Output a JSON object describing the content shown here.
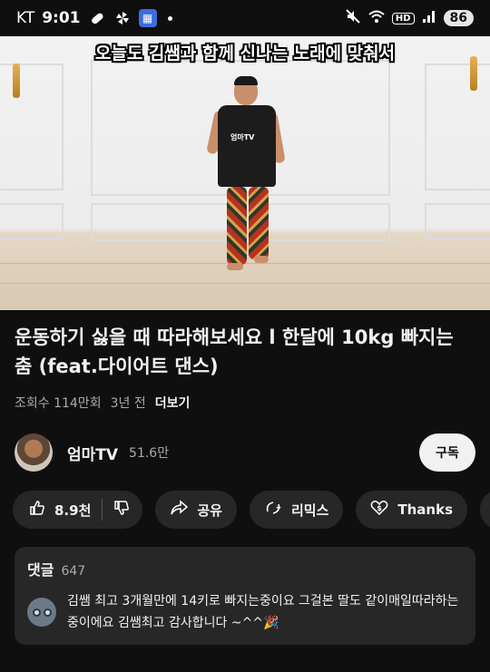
{
  "status_bar": {
    "carrier": "KT",
    "time": "9:01",
    "network_badge": "HD",
    "battery": "86"
  },
  "video": {
    "caption": "오늘도 김쌤과 함께 신나는 노래에 맞춰서",
    "shirt_logo": "엄마TV"
  },
  "title": "운동하기 싫을 때 따라해보세요 l 한달에 10kg 빠지는 춤 (feat.다이어트 댄스)",
  "meta": {
    "views": "조회수 114만회",
    "age": "3년 전",
    "more": "더보기"
  },
  "channel": {
    "name": "엄마TV",
    "subscribers": "51.6만",
    "subscribe_label": "구독"
  },
  "actions": {
    "likes": "8.9천",
    "share": "공유",
    "remix": "리믹스",
    "thanks": "Thanks"
  },
  "comments": {
    "title": "댓글",
    "count": "647",
    "top_comment": "김쌤 최고 3개월만에 14키로 빠지는중이요 그걸본 딸도 같이매일따라하는중이에요 김쌤최고 감사합니다 ~^^🎉"
  },
  "icons": [
    "alarm-icon",
    "pinwheel-icon",
    "app-icon",
    "mute-icon",
    "wifi-icon",
    "signal-icon",
    "like-icon",
    "dislike-icon",
    "share-icon",
    "remix-icon",
    "thanks-icon",
    "download-icon"
  ]
}
